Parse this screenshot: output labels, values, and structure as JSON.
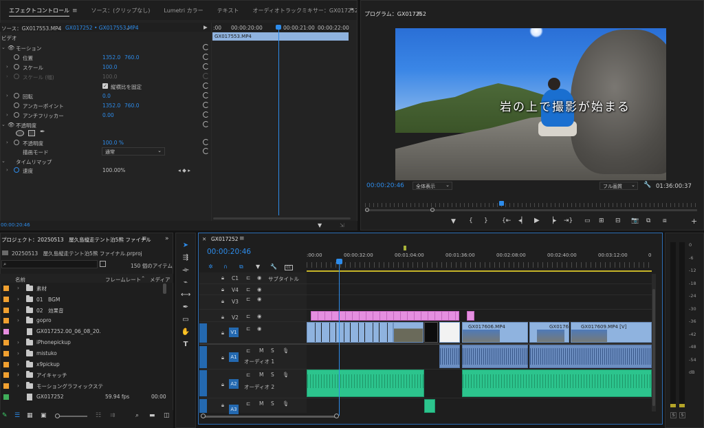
{
  "effect_controls": {
    "tabs": [
      "エフェクトコントロール",
      "ソース：(クリップなし)",
      "Lumetri カラー",
      "テキスト",
      "オーディオトラックミキサー：GX017252",
      "オ"
    ],
    "source_label": "ソース：GX017553.MP4",
    "sequence_label": "GX017252 • GX017553.MP4",
    "timecodes": [
      ":00",
      "00:00:20:00",
      "00:00:21:00",
      "00:00:22:00"
    ],
    "clip_label": "GX017553.MP4",
    "section_video": "ビデオ",
    "motion": "モーション",
    "position_label": "位置",
    "position_x": "1352.0",
    "position_y": "760.0",
    "scale_label": "スケール",
    "scale_value": "100.0",
    "scale_w_label": "スケール (幅)",
    "scale_w_value": "100.0",
    "uniform_scale": "縦横比を固定",
    "rotation_label": "回転",
    "rotation_value": "0.0",
    "anchor_label": "アンカーポイント",
    "anchor_x": "1352.0",
    "anchor_y": "760.0",
    "antiflicker_label": "アンチフリッカー",
    "antiflicker_value": "0.00",
    "opacity_section": "不透明度",
    "opacity_label": "不透明度",
    "opacity_value": "100.0 %",
    "blend_label": "描画モード",
    "blend_value": "通常",
    "timeremap_section": "タイムリマップ",
    "speed_label": "速度",
    "speed_value": "100.00%",
    "bottom_timecode": "00:00:20:46"
  },
  "program": {
    "title": "プログラム：GX017252",
    "subtitle": "岩の上で撮影が始まる",
    "timecode": "00:00:20:46",
    "fit": "全体表示",
    "quality": "フル画質",
    "duration": "01:36:00:37"
  },
  "project": {
    "title": "プロジェクト：20250513　屋久島縦走テント泊5熊 ファイナル",
    "path": "20250513　屋久島縦走テント泊5熊 ファイナル.prproj",
    "count": "150 個のアイテム",
    "col_name": "名前",
    "col_rate": "フレームレート",
    "col_media": "メディア",
    "items": [
      {
        "name": "素材",
        "color": "#f0a030",
        "type": "folder",
        "rate": "",
        "media": ""
      },
      {
        "name": "01　BGM",
        "color": "#f0a030",
        "type": "folder",
        "rate": "",
        "media": ""
      },
      {
        "name": "02　効果音",
        "color": "#f0a030",
        "type": "folder",
        "rate": "",
        "media": ""
      },
      {
        "name": "gopro",
        "color": "#f0a030",
        "type": "folder",
        "rate": "",
        "media": ""
      },
      {
        "name": "GX017252.00_06_08_20.",
        "color": "#e88ee0",
        "type": "file",
        "rate": "",
        "media": ""
      },
      {
        "name": "iPhonepickup",
        "color": "#f0a030",
        "type": "folder",
        "rate": "",
        "media": ""
      },
      {
        "name": "mistuko",
        "color": "#f0a030",
        "type": "folder",
        "rate": "",
        "media": ""
      },
      {
        "name": "x9pickup",
        "color": "#f0a030",
        "type": "folder",
        "rate": "",
        "media": ""
      },
      {
        "name": "アイキャッチ",
        "color": "#f0a030",
        "type": "folder",
        "rate": "",
        "media": ""
      },
      {
        "name": "モーショングラフィックステ",
        "color": "#f0a030",
        "type": "folder",
        "rate": "",
        "media": ""
      },
      {
        "name": "GX017252",
        "color": "#3fae5a",
        "type": "file",
        "rate": "59.94 fps",
        "media": "00:00"
      }
    ]
  },
  "timeline": {
    "title": "GX017252",
    "timecode": "00:00:20:46",
    "ruler": [
      ":00:00",
      "00:00:32:00",
      "00:01:04:00",
      "00:01:36:00",
      "00:02:08:00",
      "00:02:40:00",
      "00:03:12:00",
      "0"
    ],
    "tracks": {
      "c1": "C1",
      "v4": "V4",
      "v3": "V3",
      "v2": "V2",
      "v1": "V1",
      "a1": "A1",
      "a2": "A2",
      "a3": "A3",
      "subtitle": "サブタイトル",
      "audio1": "オーディオ 1",
      "audio2": "オーディオ 2",
      "m": "M",
      "s": "S"
    },
    "clips": {
      "v1a": "GX017606.MP4",
      "v1b": "GX0176",
      "v1c": "GX017609.MP4 [V]"
    }
  },
  "meter": {
    "labels": [
      "0",
      "-6",
      "-12",
      "-18",
      "-24",
      "-30",
      "-36",
      "-42",
      "-48",
      "-54",
      "dB"
    ],
    "solo_left": "S",
    "solo_right": "S"
  }
}
